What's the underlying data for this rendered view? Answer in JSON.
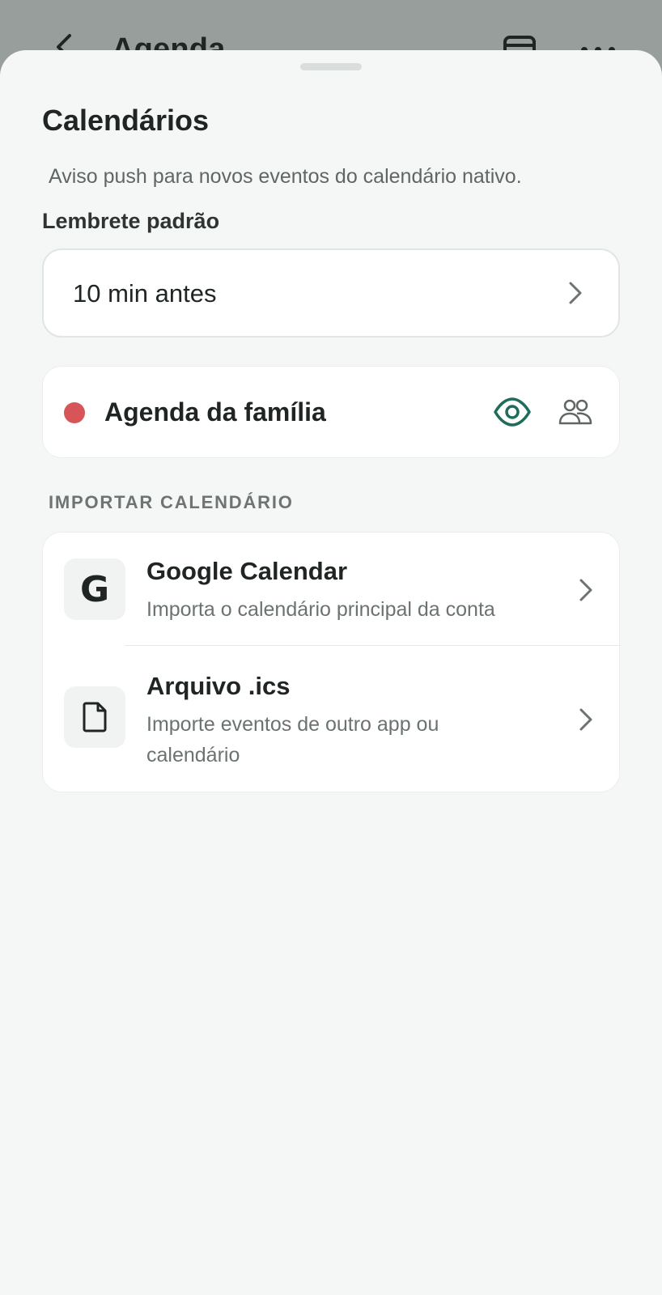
{
  "backdrop": {
    "title": "Agenda"
  },
  "sheet": {
    "title": "Calendários",
    "description": "Aviso push para novos eventos do calendário nativo.",
    "reminder_label": "Lembrete padrão",
    "reminder_value": "10 min antes"
  },
  "calendar": {
    "name": "Agenda da família",
    "color": "#d55558"
  },
  "import_section": {
    "label": "IMPORTAR CALENDÁRIO",
    "items": [
      {
        "icon": "google-g-icon",
        "icon_glyph": "G",
        "title": "Google Calendar",
        "subtitle": "Importa o calendário principal da conta"
      },
      {
        "icon": "file-icon",
        "title": "Arquivo .ics",
        "subtitle": "Importe eventos de outro app ou calendário"
      }
    ]
  },
  "colors": {
    "accent": "#1f6b5c",
    "sheet_background": "#f5f7f6",
    "backdrop": "#979e9b"
  }
}
